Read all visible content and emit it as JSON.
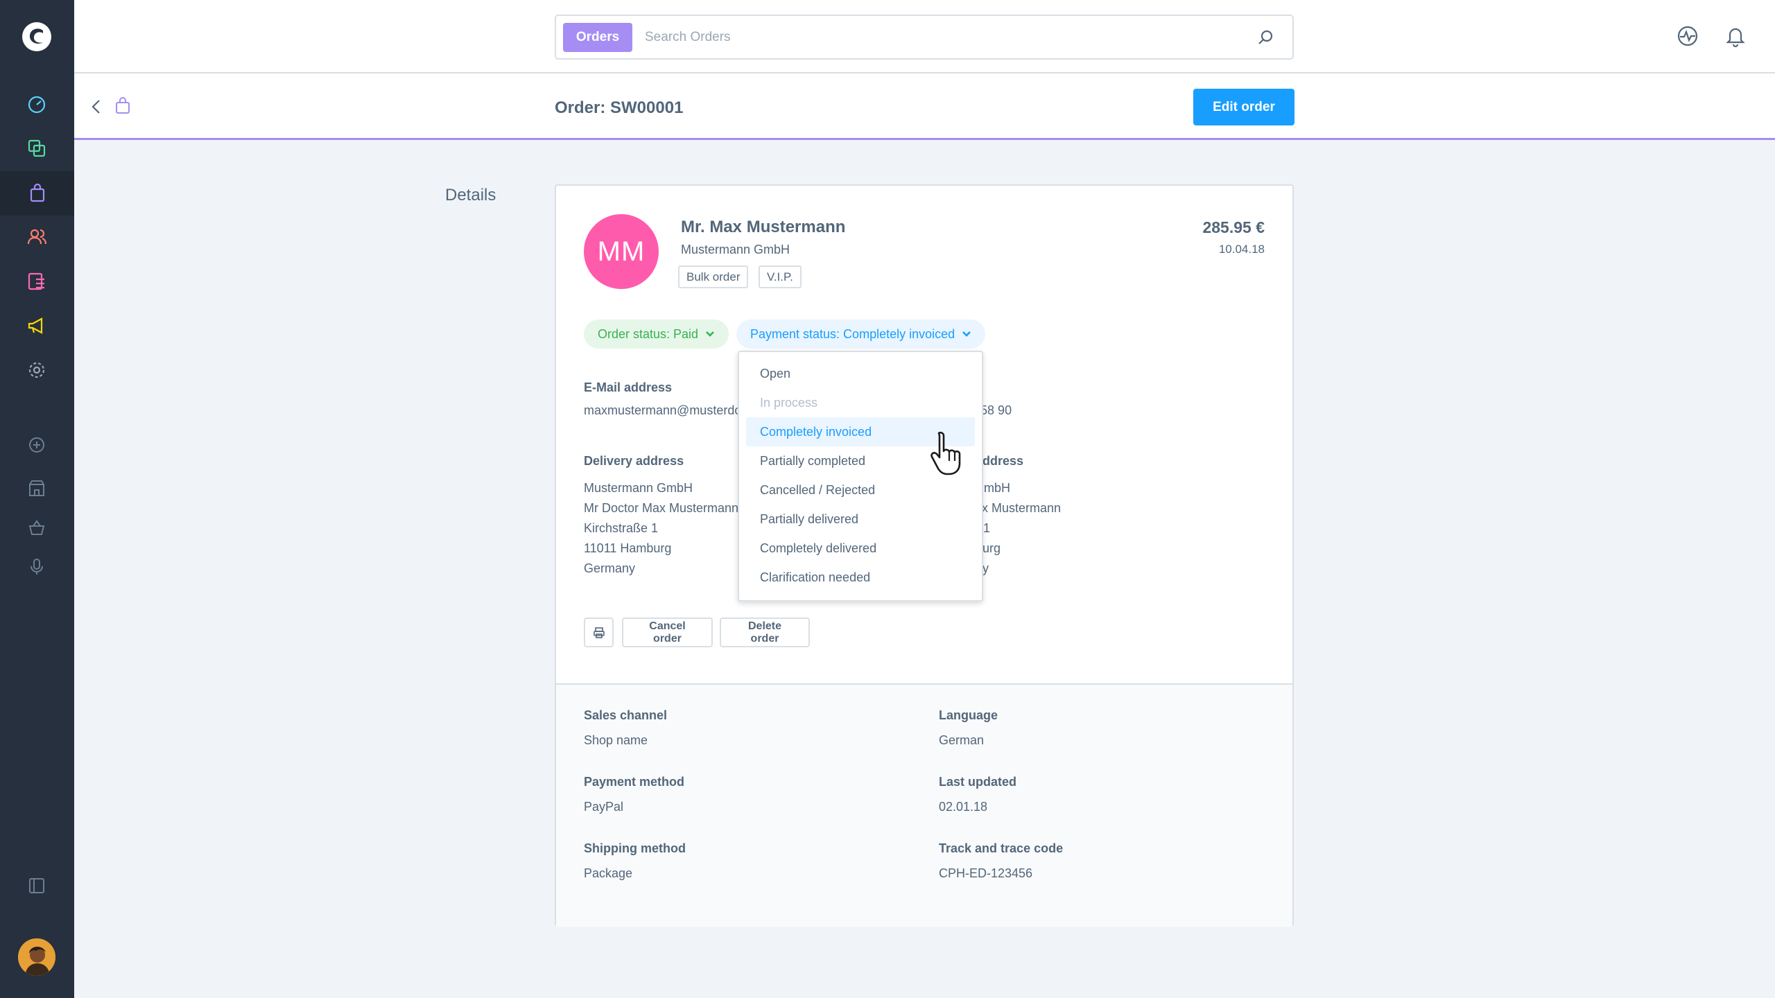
{
  "search": {
    "type_label": "Orders",
    "placeholder": "Search Orders"
  },
  "smartbar": {
    "title": "Order: SW00001",
    "edit_label": "Edit order"
  },
  "section": {
    "label": "Details"
  },
  "customer": {
    "initials": "MM",
    "name": "Mr. Max Mustermann",
    "company": "Mustermann GmbH",
    "tags": [
      "Bulk order",
      "V.I.P."
    ],
    "price": "285.95 €",
    "date": "10.04.18"
  },
  "status": {
    "order": "Order status: Paid",
    "payment": "Payment status: Completely invoiced"
  },
  "contact": {
    "email_label": "E-Mail address",
    "email_value": "maxmustermann@musterdo",
    "phone_value": "1 12 58 90"
  },
  "delivery": {
    "label": "Delivery address",
    "lines": [
      "Mustermann GmbH",
      "Mr Doctor Max Mustermann",
      "Kirchstraße 1",
      "11011 Hamburg",
      "Germany"
    ]
  },
  "billing": {
    "label": "ddress",
    "lines": [
      "nann GmbH",
      "or Max Mustermann",
      "aße 1",
      "amburg",
      "y"
    ]
  },
  "actions": {
    "cancel": "Cancel order",
    "delete": "Delete order"
  },
  "details": {
    "sales_channel_label": "Sales channel",
    "sales_channel_value": "Shop name",
    "language_label": "Language",
    "language_value": "German",
    "payment_method_label": "Payment method",
    "payment_method_value": "PayPal",
    "last_updated_label": "Last updated",
    "last_updated_value": "02.01.18",
    "shipping_method_label": "Shipping method",
    "shipping_method_value": "Package",
    "tracking_label": "Track and trace code",
    "tracking_value": "CPH-ED-123456"
  },
  "dropdown": {
    "items": [
      "Open",
      "In process",
      "Completely invoiced",
      "Partially completed",
      "Cancelled / Rejected",
      "Partially delivered",
      "Completely delivered",
      "Clarification needed"
    ],
    "selected": "Completely invoiced",
    "disabled": "In process"
  },
  "colors": {
    "sidebar": "#26303e",
    "accent": "#189eff",
    "module": "#a58df4",
    "avatar": "#ff5bac",
    "paid": "#37b24d"
  }
}
